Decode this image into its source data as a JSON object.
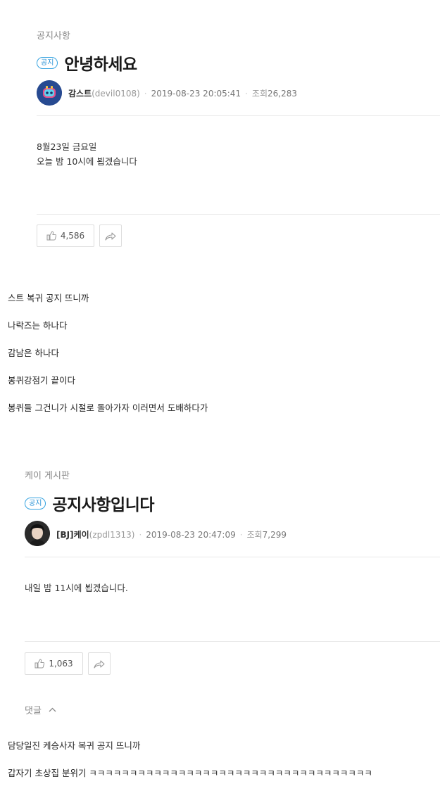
{
  "post1": {
    "board": "공지사항",
    "badge": "공지",
    "title": "안녕하세요",
    "author": "감스트",
    "author_id": "(devil0108)",
    "datetime": "2019-08-23 20:05:41",
    "views_label": "조회",
    "views": "26,283",
    "body": [
      "8월23일 금요일",
      "오늘 밤 10시에 뵙겠습니다"
    ],
    "likes": "4,586"
  },
  "comments1": [
    "스트 복귀 공지 뜨니까",
    "나락즈는 하나다",
    "감남은 하나다",
    "봉퀴강점기 끝이다",
    "봉퀴들 그건니가 시절로 돌아가자 이러면서 도배하다가"
  ],
  "post2": {
    "board": "케이 게시판",
    "badge": "공지",
    "title": "공지사항입니다",
    "author": "[BJ]케이",
    "author_id": "(zpdl1313)",
    "datetime": "2019-08-23 20:47:09",
    "views_label": "조회",
    "views": "7,299",
    "body": [
      "내일 밤 11시에 뵙겠습니다."
    ],
    "likes": "1,063",
    "replies_label": "댓글"
  },
  "comments2": [
    "담당일진 케승사자 복귀 공지 뜨니까",
    "갑자기 초상집 분위기 ㅋㅋㅋㅋㅋㅋㅋㅋㅋㅋㅋㅋㅋㅋㅋㅋㅋㅋㅋㅋㅋㅋㅋㅋㅋㅋㅋㅋㅋㅋㅋㅋㅋㅋㅋ"
  ]
}
